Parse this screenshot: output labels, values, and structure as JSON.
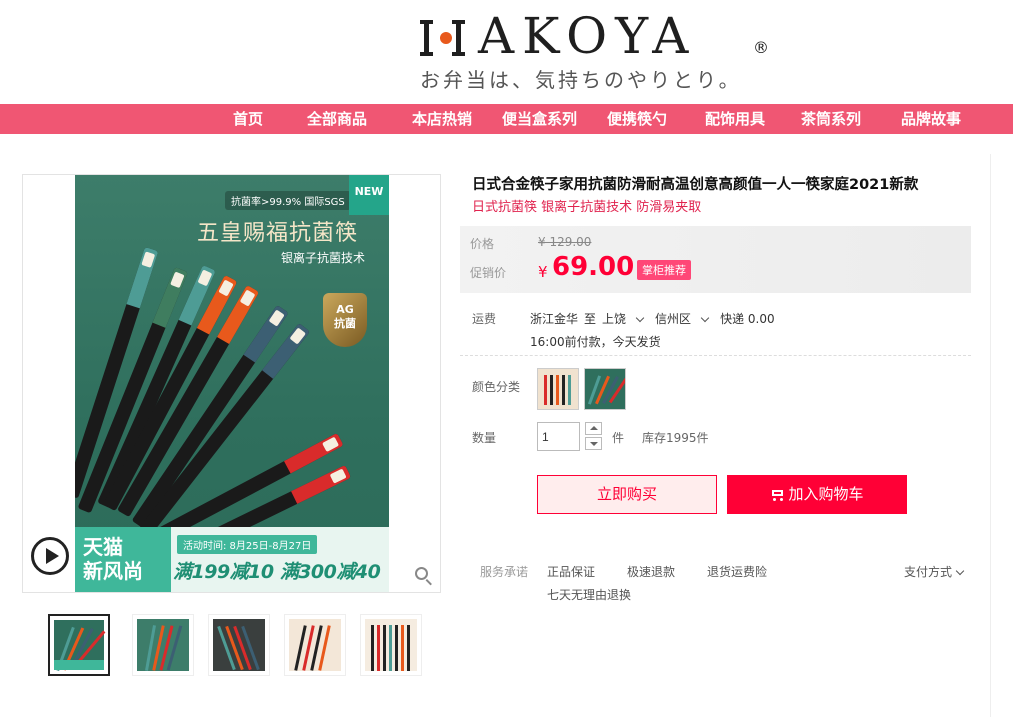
{
  "brand": {
    "logo_text": "AKOYA",
    "registered": "®",
    "tagline": "お弁当は、気持ちのやりとり。"
  },
  "nav": {
    "items": [
      "首页",
      "全部商品",
      "本店热销",
      "便当盒系列",
      "便携筷勺",
      "配饰用具",
      "茶筒系列",
      "品牌故事"
    ]
  },
  "gallery": {
    "badge": "NEW",
    "top_label": "抗菌率>99.9% 国际SGS",
    "headline": "五皇赐福抗菌筷",
    "sub_headline": "银离子抗菌技术",
    "ag_badge": "AG\n抗菌",
    "promo_left": "天猫\n新风尚",
    "promo_time": "活动时间: 8月25日-8月27日",
    "promo_deal": "满199减10 满300减40"
  },
  "product": {
    "title": "日式合金筷子家用抗菌防滑耐高温创意高颜值一人一筷家庭2021新款",
    "subtitle": "日式抗菌筷 银离子抗菌技术 防滑易夹取",
    "price_label": "价格",
    "original_price": "¥ 129.00",
    "promo_label": "促销价",
    "currency": "¥",
    "current_price": "69.00",
    "promo_tag": "掌柜推荐",
    "shipping_label": "运费",
    "ship_from": "浙江金华",
    "ship_to_word": "至",
    "ship_city": "上饶",
    "ship_district": "信州区",
    "ship_fee": "快递 0.00",
    "ship_time": "16:00前付款，今天发货",
    "color_label": "颜色分类",
    "qty_label": "数量",
    "qty_value": "1",
    "qty_unit": "件",
    "stock": "库存1995件",
    "buy_label": "立即购买",
    "cart_label": "加入购物车",
    "service_label": "服务承诺",
    "services": [
      "正品保证",
      "极速退款",
      "退货运费险"
    ],
    "service_extra": "七天无理由退换",
    "payment_label": "支付方式"
  },
  "colors": {
    "nav_bg": "#f05673",
    "price_red": "#ff0036",
    "teal": "#2f6f5d"
  }
}
